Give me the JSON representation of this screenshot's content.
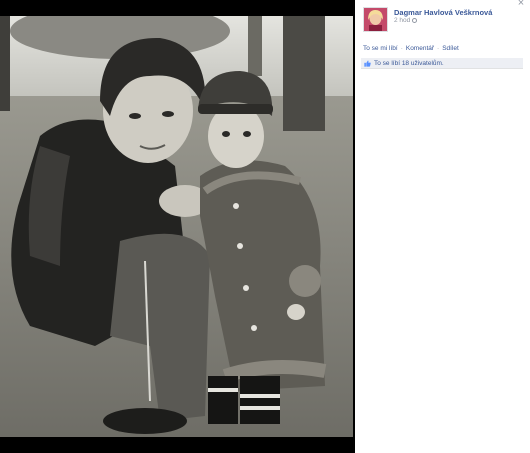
{
  "post": {
    "author": "Dagmar Havlová Veškrnová",
    "time": "2 hod",
    "privacy_icon": "globe-icon"
  },
  "actions": {
    "like": "To se mi líbí",
    "separator": "·",
    "comment": "Komentář",
    "share": "Sdílet"
  },
  "likes": {
    "text": "To se líbí 18 uživatelům.",
    "icon": "thumbs-up-icon"
  },
  "close": {
    "label": "×",
    "icon": "close-icon"
  },
  "colors": {
    "link": "#3b5998",
    "muted": "#9197a3",
    "likes_bar": "#edeff4",
    "stage": "#000000"
  }
}
